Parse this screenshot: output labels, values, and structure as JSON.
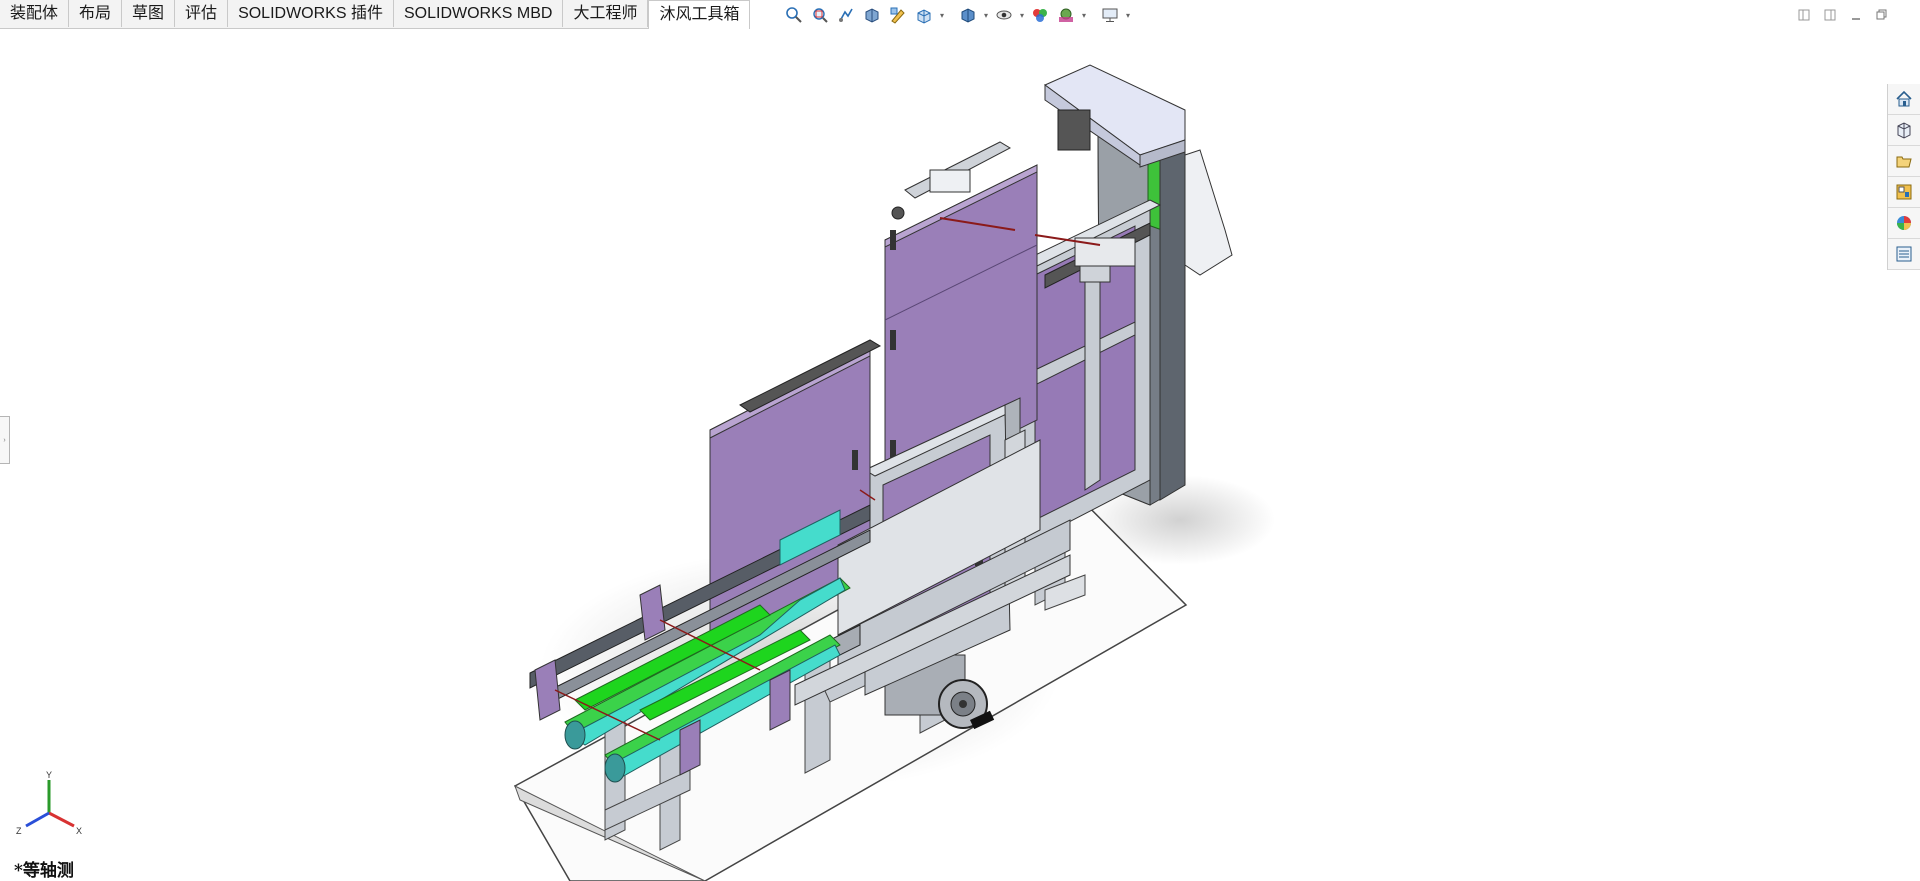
{
  "tabs": [
    {
      "label": "装配体"
    },
    {
      "label": "布局"
    },
    {
      "label": "草图"
    },
    {
      "label": "评估"
    },
    {
      "label": "SOLIDWORKS 插件"
    },
    {
      "label": "SOLIDWORKS MBD"
    },
    {
      "label": "大工程师"
    },
    {
      "label": "沐风工具箱",
      "active": true
    }
  ],
  "heads_up_toolbar": {
    "icons": [
      "zoom-to-fit-icon",
      "zoom-to-area-icon",
      "previous-view-icon",
      "section-view-icon",
      "dynamic-annotation-icon",
      "view-orientation-icon",
      "display-style-icon",
      "hide-show-items-icon",
      "edit-appearance-icon",
      "apply-scene-icon",
      "view-settings-icon"
    ]
  },
  "window_controls": [
    "tile-left-icon",
    "tile-right-icon",
    "minimize-icon",
    "restore-icon"
  ],
  "task_pane": [
    "home-icon",
    "design-library-icon",
    "file-explorer-icon",
    "view-palette-icon",
    "appearances-icon",
    "custom-properties-icon"
  ],
  "triad": {
    "x": "X",
    "y": "Y",
    "z": "Z"
  },
  "view_label": "*等轴测",
  "colors": {
    "purple_panel": "#9a7fb8",
    "green_belt": "#22dd22",
    "cyan_belt": "#44dddd",
    "steel": "#b8bec6",
    "top_cap": "#dfe2f2"
  }
}
